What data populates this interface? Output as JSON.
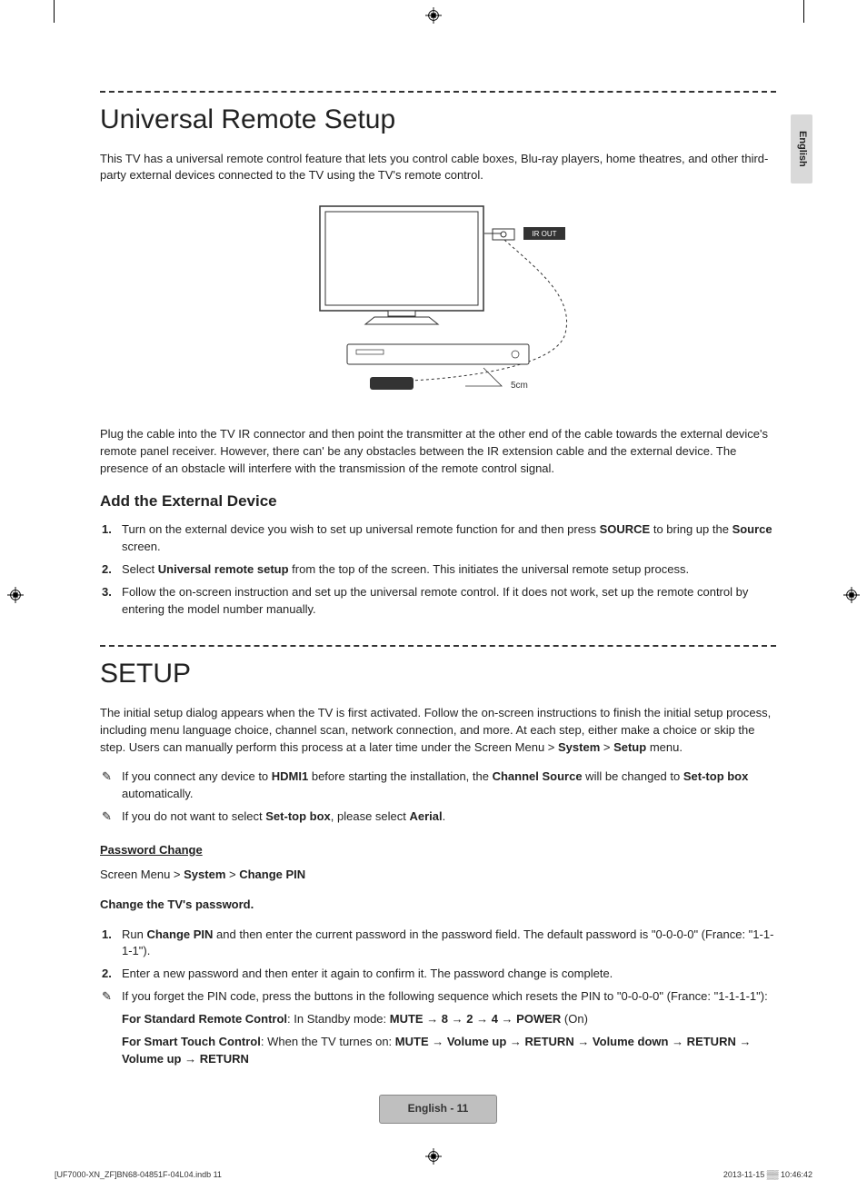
{
  "lang_tab": "English",
  "section1": {
    "title": "Universal Remote Setup",
    "intro": "This TV has a universal remote control feature that lets you control cable boxes, Blu-ray players, home theatres, and other third-party external devices connected to the TV using the TV's remote control.",
    "figure": {
      "ir_out_label": "IR OUT",
      "distance_label": "5cm"
    },
    "after_figure": "Plug the cable into the TV IR connector and then point the transmitter at the other end of the cable towards the external device's remote panel receiver. However, there can' be any obstacles between the IR extension cable and the external device. The presence of an obstacle will interfere with the transmission of the remote control signal.",
    "sub_title": "Add the External Device",
    "steps": {
      "n1": "1.",
      "s1_a": "Turn on the external device you wish to set up universal remote function for and then press ",
      "s1_b": "SOURCE",
      "s1_c": " to bring up the ",
      "s1_d": "Source",
      "s1_e": " screen.",
      "n2": "2.",
      "s2_a": "Select ",
      "s2_b": "Universal remote setup",
      "s2_c": " from the top of the screen. This initiates the universal remote setup process.",
      "n3": "3.",
      "s3": "Follow the on-screen instruction and set up the universal remote control. If it does not work, set up the remote control by entering the model number manually."
    }
  },
  "section2": {
    "title": "SETUP",
    "intro_a": "The initial setup dialog appears when the TV is first activated. Follow the on-screen instructions to finish the initial setup process, including menu language choice, channel scan, network connection, and more. At each step, either make a choice or skip the step. Users can manually perform this process at a later time under the Screen Menu > ",
    "intro_b": "System",
    "intro_c": " > ",
    "intro_d": "Setup",
    "intro_e": " menu.",
    "notes": {
      "n1_a": "If you connect any device to ",
      "n1_b": "HDMI1",
      "n1_c": " before starting the installation, the ",
      "n1_d": "Channel Source",
      "n1_e": " will be changed to ",
      "n1_f": "Set-top box",
      "n1_g": " automatically.",
      "n2_a": "If you do not want to select ",
      "n2_b": "Set-top box",
      "n2_c": ", please select ",
      "n2_d": "Aerial",
      "n2_e": "."
    },
    "pw": {
      "heading": "Password Change",
      "path_a": "Screen Menu > ",
      "path_b": "System",
      "path_c": " > ",
      "path_d": "Change PIN",
      "lead": "Change the TV's password.",
      "n1": "1.",
      "s1_a": "Run ",
      "s1_b": "Change PIN",
      "s1_c": " and then enter the current password in the password field. The default password is \"0-0-0-0\" (France: \"1-1-1-1\").",
      "n2": "2.",
      "s2": "Enter a new password and then enter it again to confirm it. The password change is complete.",
      "note_a": "If you forget the PIN code, press the buttons in the following sequence which resets the PIN to  \"0-0-0-0\" (France: \"1-1-1-1\"):",
      "std_a": "For Standard Remote Control",
      "std_b": ": In Standby mode: ",
      "std_seq": "MUTE → 8 → 2 → 4 → POWER",
      "std_c": " (On)",
      "smart_a": "For Smart Touch Control",
      "smart_b": ": When the TV turnes on: ",
      "smart_seq": "MUTE → Volume up → RETURN → Volume down → RETURN → Volume up → RETURN"
    }
  },
  "page_badge": "English - 11",
  "footer": {
    "left": "[UF7000-XN_ZF]BN68-04851F-04L04.indb   11",
    "right": "2013-11-15   ▒▒ 10:46:42"
  }
}
